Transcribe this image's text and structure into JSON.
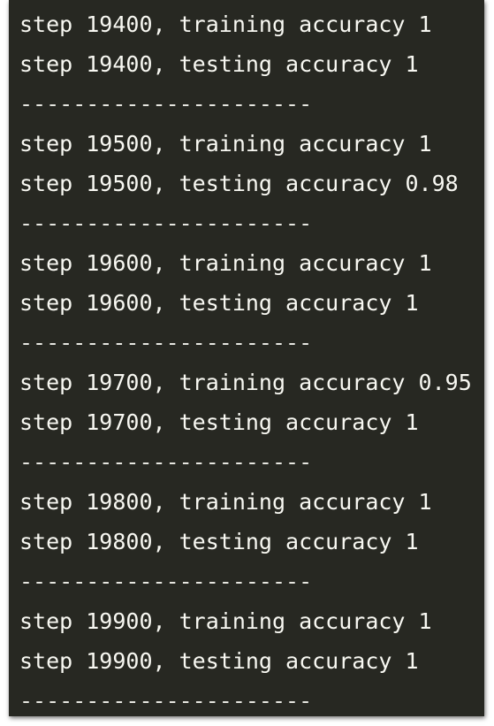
{
  "terminal": {
    "background": "#272822",
    "foreground": "#f8f8f2",
    "lines": [
      "step 19400, training accuracy 1",
      "step 19400, testing accuracy 1",
      "----------------------",
      "step 19500, training accuracy 1",
      "step 19500, testing accuracy 0.98",
      "----------------------",
      "step 19600, training accuracy 1",
      "step 19600, testing accuracy 1",
      "----------------------",
      "step 19700, training accuracy 0.95",
      "step 19700, testing accuracy 1",
      "----------------------",
      "step 19800, training accuracy 1",
      "step 19800, testing accuracy 1",
      "----------------------",
      "step 19900, training accuracy 1",
      "step 19900, testing accuracy 1",
      "----------------------"
    ]
  }
}
